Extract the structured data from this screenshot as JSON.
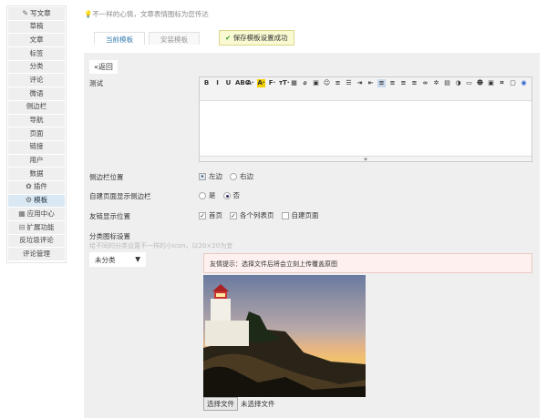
{
  "sidebar": {
    "items": [
      {
        "label": "写文章",
        "icon": "edit-icon"
      },
      {
        "label": "草稿"
      },
      {
        "label": "文章"
      },
      {
        "label": "标签"
      },
      {
        "label": "分类"
      },
      {
        "label": "评论"
      },
      {
        "label": "微语"
      },
      {
        "label": "侧边栏"
      },
      {
        "label": "导航"
      },
      {
        "label": "页面"
      },
      {
        "label": "链接"
      },
      {
        "label": "用户"
      },
      {
        "label": "数据"
      },
      {
        "label": "插件",
        "icon": "plugin-icon"
      },
      {
        "label": "模板",
        "icon": "gear-icon",
        "active": true
      },
      {
        "label": "应用中心",
        "icon": "store-icon"
      },
      {
        "label": "扩展功能",
        "icon": "collapse-icon"
      },
      {
        "label": "反垃圾评论"
      },
      {
        "label": "评论管理"
      }
    ]
  },
  "header": {
    "motto": "不一样的心情，文章表情图标为您传达"
  },
  "tabs": [
    {
      "label": "当前模板"
    },
    {
      "label": "安装模板"
    }
  ],
  "toast": "保存模板设置成功",
  "form": {
    "back": "«返回",
    "test_label": "测试",
    "sidebar_pos_label": "侧边栏位置",
    "sidebar_pos_options": [
      "左边",
      "右边"
    ],
    "custom_page_label": "自建页面显示侧边栏",
    "custom_page_options": [
      "是",
      "否"
    ],
    "links_label": "友链显示位置",
    "links_options": [
      "首页",
      "各个列表页",
      "自建页面"
    ],
    "cat_icon_label": "分类图标设置",
    "cat_icon_hint": "给不同的分类设置不一样的小icon，以20×20为宜",
    "category_select": "未分类",
    "tip": "友情提示：选择文件后将会立刻上传覆盖原图",
    "choose_file": "选择文件",
    "no_file": "未选择文件"
  },
  "editor_toolbar": [
    "B",
    "I",
    "U",
    "ABC",
    "A·",
    "A·",
    "F·",
    "тT·",
    "▦",
    "⌀",
    "▣",
    "☺",
    "≡",
    "☰",
    "⇥",
    "⇤",
    "≡",
    "≡",
    "≡",
    "≡",
    "∞",
    "✲",
    "▤",
    "◑",
    "▭",
    "☻",
    "▣",
    "⌗",
    "▢",
    "◉"
  ]
}
